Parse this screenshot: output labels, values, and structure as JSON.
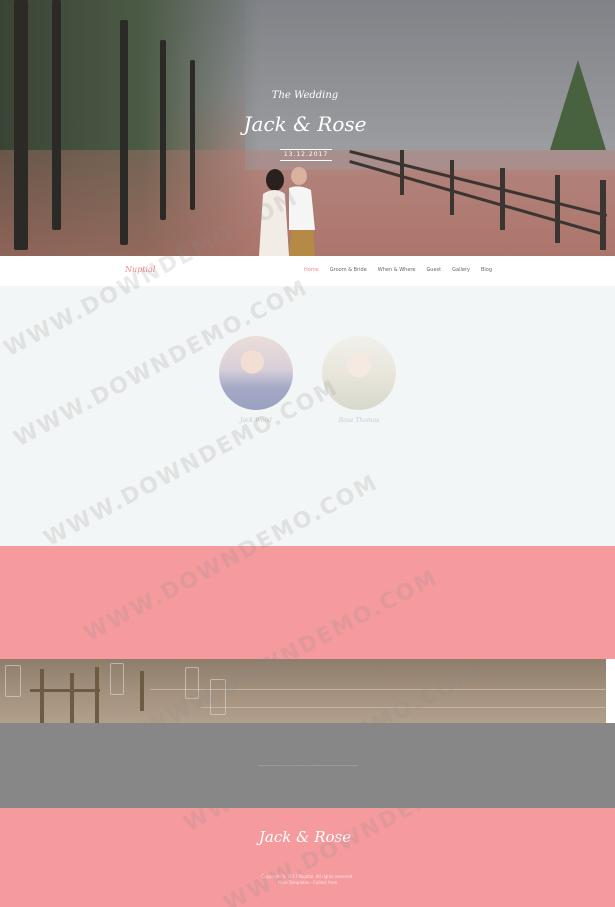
{
  "hero": {
    "subtitle": "The Wedding",
    "title": "Jack & Rose",
    "date": "13.12.2017"
  },
  "nav": {
    "logo": "Nuptial",
    "items": [
      {
        "label": "Home",
        "active": true
      },
      {
        "label": "Groom & Bride",
        "active": false
      },
      {
        "label": "When & Where",
        "active": false
      },
      {
        "label": "Guest",
        "active": false
      },
      {
        "label": "Gallery",
        "active": false
      },
      {
        "label": "Blog",
        "active": false
      }
    ]
  },
  "couple": {
    "groom_name": "Jack Wood",
    "bride_name": "Rose Thomas"
  },
  "footer": {
    "title": "Jack & Rose",
    "copyright": "Copyright © 2017 Nuptial. All rights reserved.",
    "credit": "More Templates - Collect from"
  },
  "watermark": {
    "text": "WWW.DOWNDEMO.COM"
  },
  "colors": {
    "accent": "#f59b9e",
    "nav_active": "#f08a8c",
    "section_bg": "#f3f6f6",
    "grey_band": "#878787"
  }
}
